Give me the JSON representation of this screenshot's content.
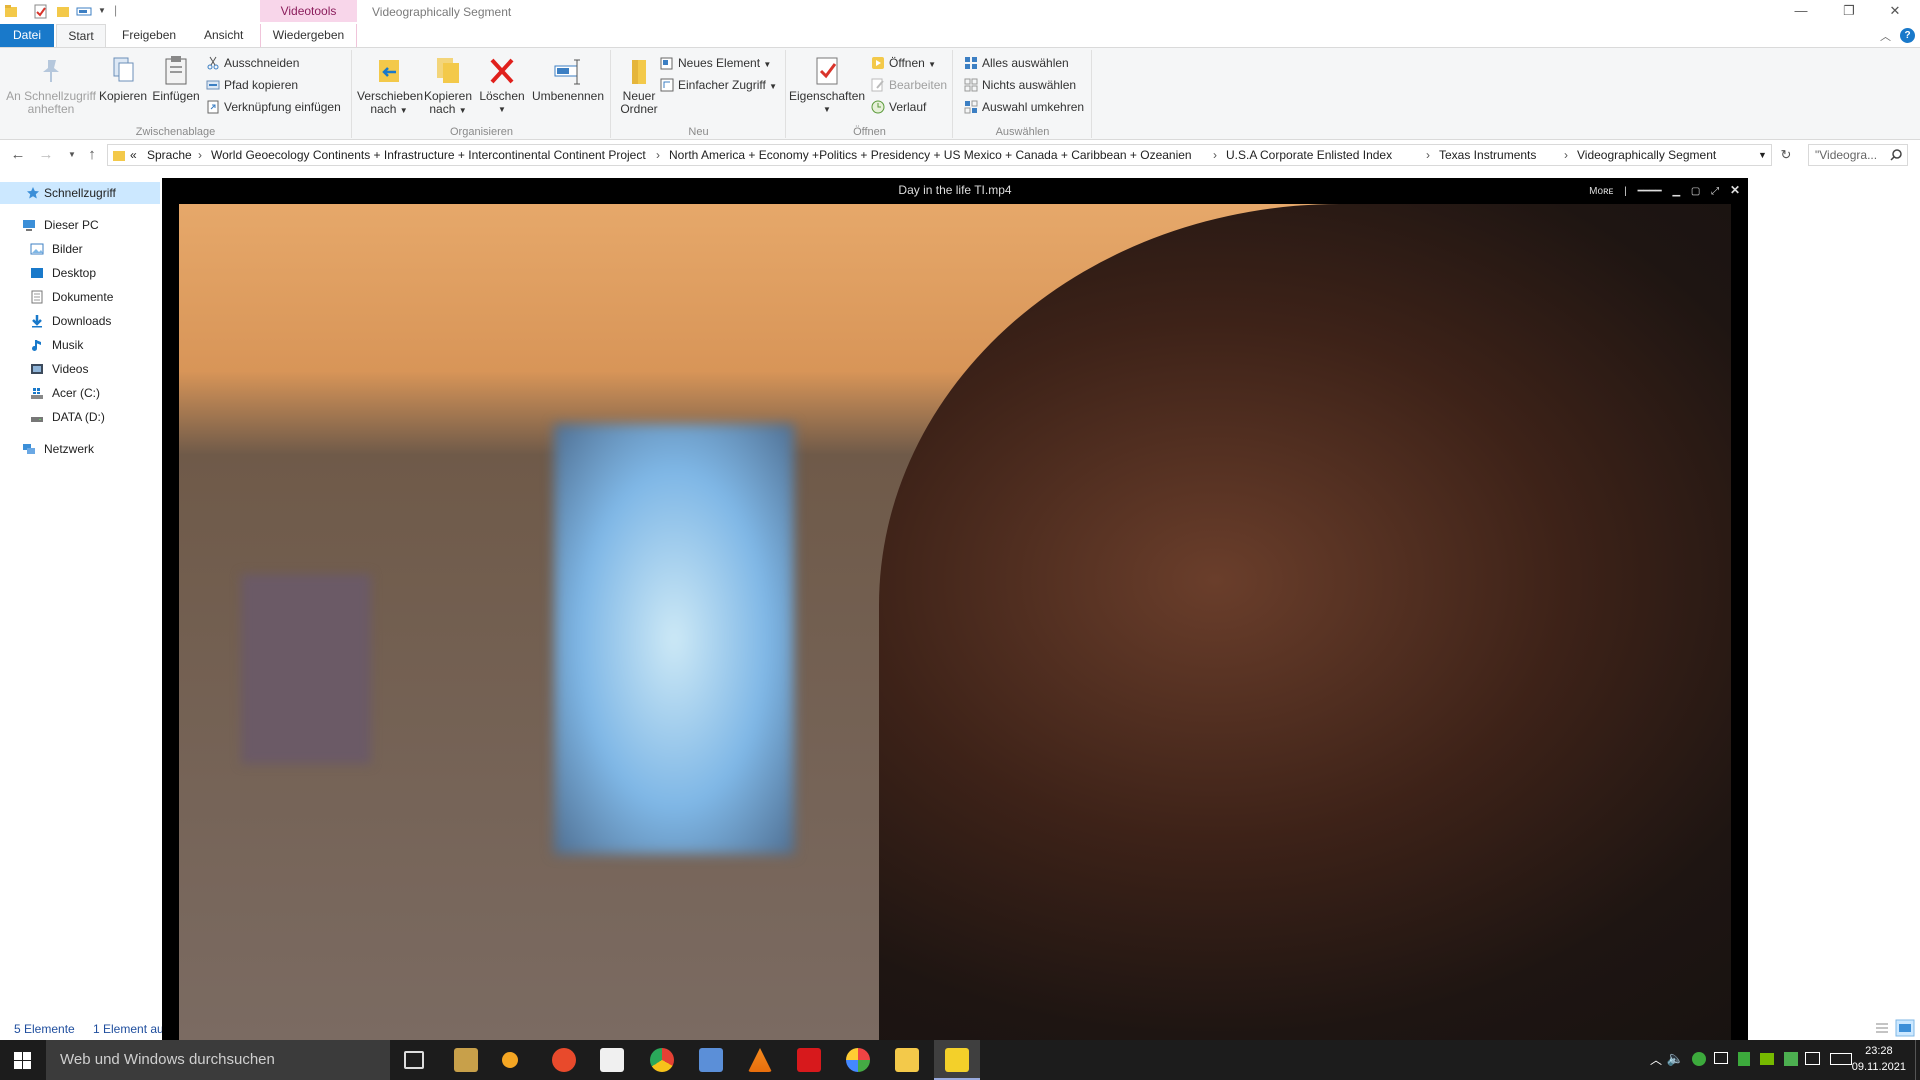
{
  "titlebar": {
    "context_tab": "Videotools",
    "window_title": "Videographically Segment"
  },
  "ribbon_tabs": {
    "datei": "Datei",
    "start": "Start",
    "freigeben": "Freigeben",
    "ansicht": "Ansicht",
    "wiedergeben": "Wiedergeben"
  },
  "ribbon": {
    "zwischenablage": {
      "label": "Zwischenablage",
      "pin_line1": "An Schnellzugriff",
      "pin_line2": "anheften",
      "kopieren": "Kopieren",
      "einfuegen": "Einfügen",
      "ausschneiden": "Ausschneiden",
      "pfad_kopieren": "Pfad kopieren",
      "verknuepfung": "Verknüpfung einfügen"
    },
    "organisieren": {
      "label": "Organisieren",
      "verschieben_line1": "Verschieben",
      "verschieben_line2": "nach",
      "kopieren_line1": "Kopieren",
      "kopieren_line2": "nach",
      "loeschen": "Löschen",
      "umbenennen": "Umbenennen"
    },
    "neu": {
      "label": "Neu",
      "neuer_line1": "Neuer",
      "neuer_line2": "Ordner",
      "neues_element": "Neues Element",
      "einfacher_zugriff": "Einfacher Zugriff"
    },
    "oeffnen": {
      "label": "Öffnen",
      "eigenschaften": "Eigenschaften",
      "oeffnen": "Öffnen",
      "bearbeiten": "Bearbeiten",
      "verlauf": "Verlauf"
    },
    "auswaehlen": {
      "label": "Auswählen",
      "alles": "Alles auswählen",
      "nichts": "Nichts auswählen",
      "umkehren": "Auswahl umkehren"
    }
  },
  "address": {
    "overflow": "«",
    "crumbs": [
      "Sprache",
      "World Geoecology Continents + Infrastructure + Intercontinental Continent Project",
      "North America + Economy +Politics + Presidency + US  Mexico + Canada + Caribbean + Ozeanien",
      "U.S.A Corporate Enlisted Index",
      "Texas Instruments",
      "Videographically Segment"
    ],
    "search_placeholder": "\"Videogra..."
  },
  "navpane": {
    "quick_access": "Schnellzugriff",
    "this_pc": "Dieser PC",
    "items": [
      "Bilder",
      "Desktop",
      "Dokumente",
      "Downloads",
      "Musik",
      "Videos",
      "Acer (C:)",
      "DATA (D:)"
    ],
    "network": "Netzwerk"
  },
  "status": {
    "count": "5 Elemente",
    "selected": "1 Element au"
  },
  "player": {
    "title": "Day in the life TI.mp4",
    "more": "Mᴏʀᴇ"
  },
  "taskbar": {
    "search_placeholder": "Web und Windows durchsuchen",
    "time": "23:28",
    "date": "09.11.2021"
  },
  "colors": {
    "accent": "#1979ca",
    "context_tab_bg": "#f8d6ea",
    "context_tab_text": "#8b1d5c",
    "taskbar_bg": "#1c1c1c",
    "selected_nav_bg": "#cce8ff"
  }
}
